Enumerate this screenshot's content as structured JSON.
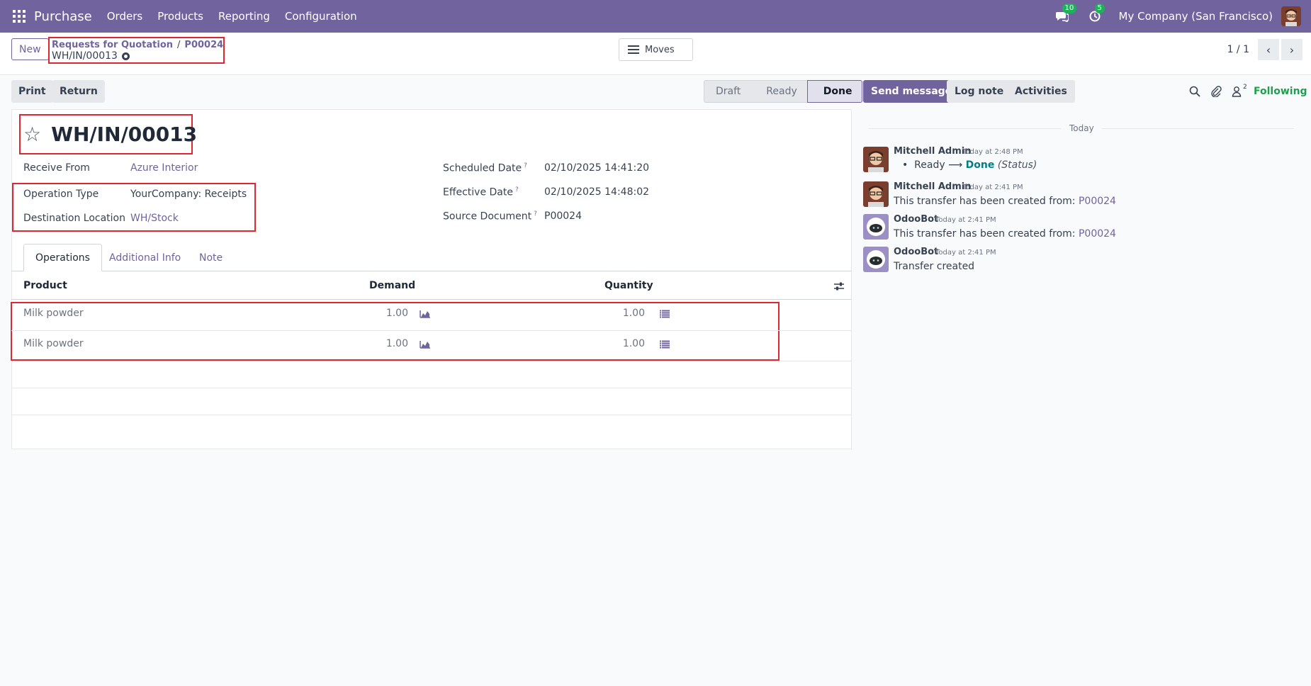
{
  "navbar": {
    "app_name": "Purchase",
    "menu": [
      "Orders",
      "Products",
      "Reporting",
      "Configuration"
    ],
    "messages_badge": "10",
    "activities_badge": "5",
    "company": "My Company (San Francisco)"
  },
  "control": {
    "new_label": "New",
    "breadcrumb": [
      "Requests for Quotation",
      "P00024"
    ],
    "current": "WH/IN/00013",
    "moves_label": "Moves",
    "pager": "1 / 1"
  },
  "actions": {
    "print": "Print",
    "return": "Return"
  },
  "stages": [
    "Draft",
    "Ready",
    "Done"
  ],
  "active_stage": "Done",
  "form": {
    "title": "WH/IN/00013",
    "receive_from_label": "Receive From",
    "receive_from": "Azure Interior",
    "operation_type_label": "Operation Type",
    "operation_type": "YourCompany: Receipts",
    "destination_label": "Destination Location",
    "destination": "WH/Stock",
    "scheduled_label": "Scheduled Date",
    "scheduled": "02/10/2025 14:41:20",
    "effective_label": "Effective Date",
    "effective": "02/10/2025 14:48:02",
    "source_label": "Source Document",
    "source": "P00024",
    "help_mark": "?"
  },
  "tabs": [
    "Operations",
    "Additional Info",
    "Note"
  ],
  "table": {
    "headers": [
      "Product",
      "Demand",
      "Quantity"
    ],
    "rows": [
      {
        "product": "Milk powder",
        "demand": "1.00",
        "quantity": "1.00"
      },
      {
        "product": "Milk powder",
        "demand": "1.00",
        "quantity": "1.00"
      }
    ]
  },
  "chatter": {
    "send_message": "Send message",
    "log_note": "Log note",
    "activities": "Activities",
    "followers_count": "2",
    "following": "Following",
    "today": "Today",
    "messages": [
      {
        "author": "Mitchell Admin",
        "date": "Today at 2:48 PM",
        "from": "Ready",
        "arrow": "⟶",
        "to": "Done",
        "field": "(Status)"
      },
      {
        "author": "Mitchell Admin",
        "date": "Today at 2:41 PM",
        "text": "This transfer has been created from:",
        "link": "P00024"
      },
      {
        "author": "OdooBot",
        "date": "Today at 2:41 PM",
        "text": "This transfer has been created from:",
        "link": "P00024"
      },
      {
        "author": "OdooBot",
        "date": "Today at 2:41 PM",
        "text": "Transfer created"
      }
    ]
  },
  "colors": {
    "brand": "#71639e",
    "highlight": "#e0262f",
    "following": "#1e9e4e"
  }
}
